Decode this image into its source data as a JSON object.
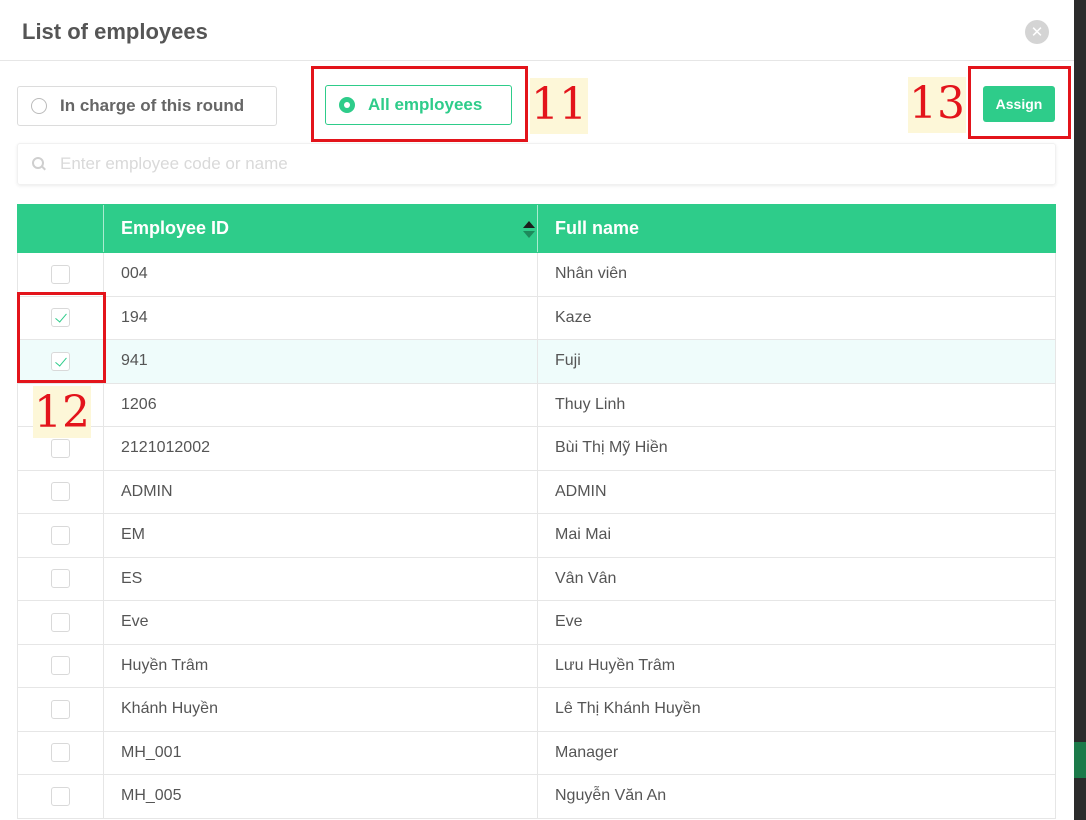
{
  "modal": {
    "title": "List of employees"
  },
  "filters": {
    "in_charge_label": "In charge of this round",
    "all_label": "All employees",
    "selected": "all"
  },
  "assign_label": "Assign",
  "search": {
    "placeholder": "Enter employee code or name",
    "value": ""
  },
  "annotations": {
    "a11": "11",
    "a12": "12",
    "a13": "13"
  },
  "table": {
    "columns": [
      "Employee ID",
      "Full name"
    ],
    "rows": [
      {
        "id": "004",
        "name": "Nhân viên",
        "checked": false
      },
      {
        "id": "194",
        "name": "Kaze",
        "checked": true
      },
      {
        "id": "941",
        "name": "Fuji",
        "checked": true
      },
      {
        "id": "1206",
        "name": "Thuy Linh",
        "checked": false
      },
      {
        "id": "2121012002",
        "name": "Bùi Thị Mỹ Hiền",
        "checked": false
      },
      {
        "id": "ADMIN",
        "name": "ADMIN",
        "checked": false
      },
      {
        "id": "EM",
        "name": "Mai Mai",
        "checked": false
      },
      {
        "id": "ES",
        "name": "Vân Vân",
        "checked": false
      },
      {
        "id": "Eve",
        "name": "Eve",
        "checked": false
      },
      {
        "id": "Huyền Trâm",
        "name": "Lưu Huyền Trâm",
        "checked": false
      },
      {
        "id": "Khánh Huyền",
        "name": "Lê Thị Khánh Huyền",
        "checked": false
      },
      {
        "id": "MH_001",
        "name": "Manager",
        "checked": false
      },
      {
        "id": "MH_005",
        "name": "Nguyễn Văn An",
        "checked": false
      }
    ]
  },
  "colors": {
    "accent": "#2ecc8a",
    "annotation": "#e3141b",
    "highlight_row": "#effcfb"
  },
  "icons": {
    "close": "close-icon",
    "search": "search-icon",
    "sort": "sort-icon"
  }
}
